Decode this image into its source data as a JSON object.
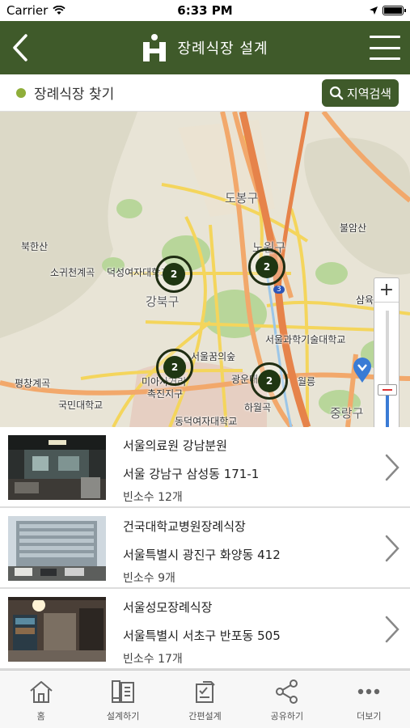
{
  "status_bar": {
    "carrier": "Carrier",
    "time": "6:33 PM"
  },
  "header": {
    "title": "장례식장 설계"
  },
  "search": {
    "label": "장례식장 찾기",
    "region_button": "지역검색"
  },
  "map": {
    "labels": [
      {
        "text": "도봉구",
        "kind": "district"
      },
      {
        "text": "노원구",
        "kind": "district"
      },
      {
        "text": "강북구",
        "kind": "district"
      },
      {
        "text": "중랑구",
        "kind": "district"
      },
      {
        "text": "광운대",
        "kind": "place"
      },
      {
        "text": "북한산",
        "kind": "place"
      },
      {
        "text": "불암산",
        "kind": "place"
      },
      {
        "text": "삼육대",
        "kind": "place"
      },
      {
        "text": "소귀천계곡",
        "kind": "place"
      },
      {
        "text": "덕성여자대학교",
        "kind": "place"
      },
      {
        "text": "서울과학기술대학교",
        "kind": "place"
      },
      {
        "text": "평창계곡",
        "kind": "place"
      },
      {
        "text": "국민대학교",
        "kind": "place"
      },
      {
        "text": "미아사거리",
        "kind": "place"
      },
      {
        "text": "촉진지구",
        "kind": "place"
      },
      {
        "text": "동덕여자대학교",
        "kind": "place"
      },
      {
        "text": "서울꿈의숲",
        "kind": "place"
      },
      {
        "text": "월릉",
        "kind": "place"
      },
      {
        "text": "하월곡",
        "kind": "place"
      },
      {
        "text": "3",
        "kind": "route"
      }
    ],
    "clusters": [
      {
        "count": "2"
      },
      {
        "count": "2"
      },
      {
        "count": "2"
      },
      {
        "count": "2"
      }
    ],
    "zoom": {
      "plus": "+",
      "level": 0.35
    }
  },
  "halls": [
    {
      "name": "서울의료원 강남분원",
      "address": "서울 강남구 삼성동 171-1",
      "rooms": "빈소수 12개"
    },
    {
      "name": "건국대학교병원장례식장",
      "address": "서울특별시 광진구 화양동 412",
      "rooms": "빈소수 9개"
    },
    {
      "name": "서울성모장례식장",
      "address": "서울특별시 서초구 반포동 505",
      "rooms": "빈소수 17개"
    }
  ],
  "tabs": [
    {
      "label": "홈",
      "icon": "home-icon"
    },
    {
      "label": "설계하기",
      "icon": "design-icon"
    },
    {
      "label": "간편설계",
      "icon": "quick-design-icon"
    },
    {
      "label": "공유하기",
      "icon": "share-icon"
    },
    {
      "label": "더보기",
      "icon": "more-icon"
    }
  ],
  "colors": {
    "header": "#3f5a2a",
    "accent_dot": "#8fae3a",
    "cluster": "#1f3612"
  }
}
